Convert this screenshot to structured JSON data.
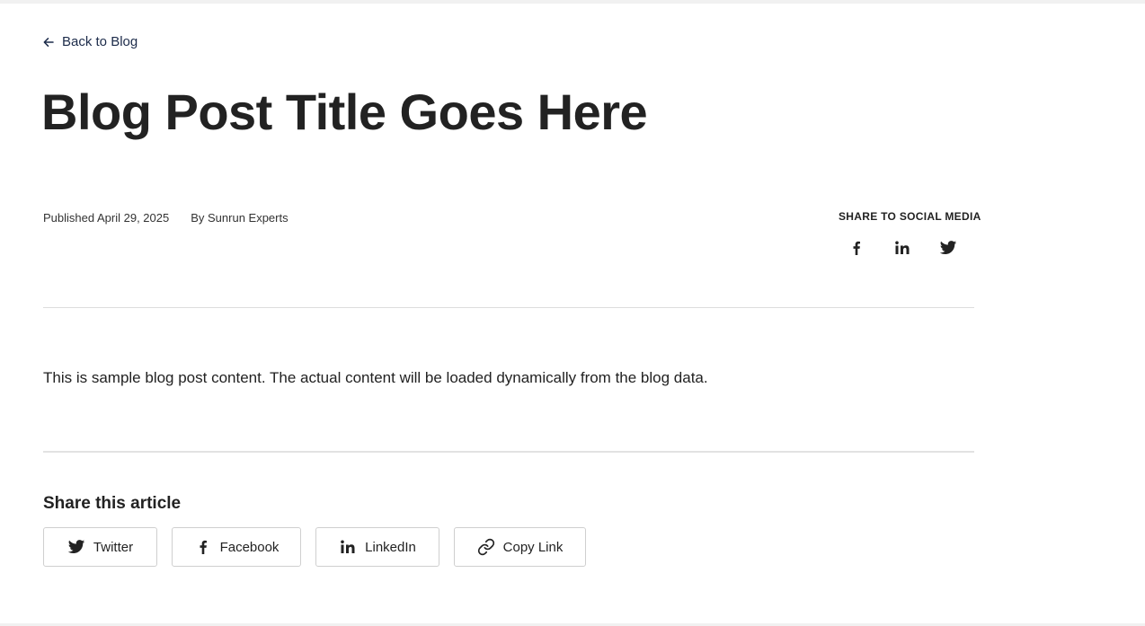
{
  "back_link": {
    "label": "Back to Blog",
    "icon": "arrow-left-icon"
  },
  "post": {
    "title": "Blog Post Title Goes Here",
    "published": "Published April 29, 2025",
    "author": "By Sunrun Experts",
    "content": "This is sample blog post content. The actual content will be loaded dynamically from the blog data."
  },
  "share_top": {
    "label": "SHARE TO SOCIAL MEDIA",
    "icons": [
      "facebook-icon",
      "linkedin-icon",
      "twitter-icon"
    ]
  },
  "share_article": {
    "heading": "Share this article",
    "buttons": [
      {
        "label": "Twitter",
        "icon": "twitter-icon"
      },
      {
        "label": "Facebook",
        "icon": "facebook-icon"
      },
      {
        "label": "LinkedIn",
        "icon": "linkedin-icon"
      },
      {
        "label": "Copy Link",
        "icon": "link-icon"
      }
    ]
  },
  "colors": {
    "text": "#222222",
    "link": "#1c2b4a",
    "divider": "#dddddd",
    "button_border": "#cfcfcf"
  }
}
